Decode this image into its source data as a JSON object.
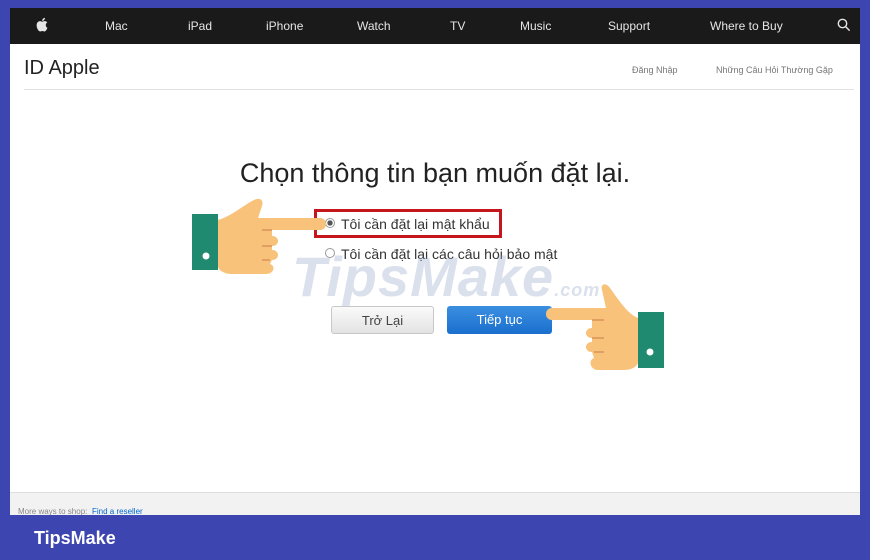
{
  "nav": {
    "apple_icon": "apple-logo-icon",
    "items": [
      "Mac",
      "iPad",
      "iPhone",
      "Watch",
      "TV",
      "Music",
      "Support",
      "Where to Buy"
    ],
    "search_icon": "search-icon"
  },
  "header": {
    "title": "ID Apple",
    "links": [
      "Đăng Nhập",
      "Những Câu Hỏi Thường Gặp"
    ]
  },
  "main": {
    "heading": "Chọn thông tin bạn muốn đặt lại.",
    "options": [
      {
        "label": "Tôi cần đặt lại mật khẩu",
        "selected": true
      },
      {
        "label": "Tôi cần đặt lại các câu hỏi bảo mật",
        "selected": false
      }
    ],
    "back_button": "Trở Lại",
    "continue_button": "Tiếp tục",
    "highlight_color": "#c4161c",
    "button_color": "#1a6fce"
  },
  "watermark": {
    "text": "TipsMake",
    "suffix": ".com"
  },
  "footer": {
    "prefix": "More ways to shop:",
    "link": "Find a reseller"
  },
  "brand": "TipsMake",
  "frame_color": "#3d45b0"
}
